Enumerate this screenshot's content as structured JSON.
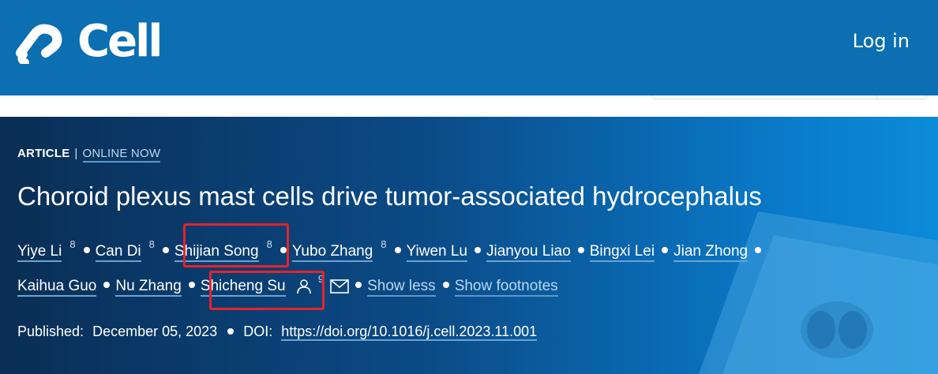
{
  "header": {
    "logo_text": "Cell",
    "login_label": "Log in"
  },
  "article": {
    "type_label": "ARTICLE",
    "separator": "|",
    "status_label": "ONLINE NOW",
    "title": "Choroid plexus mast cells drive tumor-associated hydrocephalus"
  },
  "authors": {
    "row1": [
      {
        "name": "Yiye Li",
        "sup": "8"
      },
      {
        "name": "Can Di",
        "sup": "8"
      },
      {
        "name": "Shijian Song",
        "sup": "8",
        "highlighted": true
      },
      {
        "name": "Yubo Zhang",
        "sup": "8"
      },
      {
        "name": "Yiwen Lu"
      },
      {
        "name": "Jianyou Liao"
      },
      {
        "name": "Bingxi Lei"
      },
      {
        "name": "Jian Zhong"
      }
    ],
    "row2": [
      {
        "name": "Kaihua Guo"
      },
      {
        "name": "Nu Zhang"
      },
      {
        "name": "Shicheng Su",
        "sup": "9",
        "highlighted": true,
        "corresponding": true
      }
    ],
    "show_less_label": "Show less",
    "show_footnotes_label": "Show footnotes"
  },
  "publication": {
    "published_label": "Published:",
    "published_date": "December 05, 2023",
    "doi_label": "DOI:",
    "doi_url": "https://doi.org/10.1016/j.cell.2023.11.001"
  },
  "colors": {
    "header_bg": "#0b6fb2",
    "highlight_box": "#e8222a",
    "link_color": "#b9d8f1"
  },
  "icons": [
    "cell-logo-icon",
    "person-icon",
    "envelope-icon"
  ]
}
